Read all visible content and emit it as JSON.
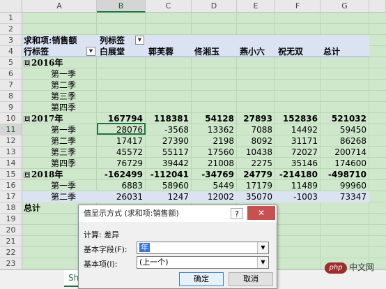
{
  "columns": [
    "A",
    "B",
    "C",
    "D",
    "E",
    "F",
    "G"
  ],
  "row_numbers": [
    "1",
    "2",
    "3",
    "4",
    "5",
    "6",
    "7",
    "8",
    "9",
    "10",
    "11",
    "12",
    "13",
    "14",
    "15",
    "16",
    "17",
    "18",
    "19",
    "20",
    "21",
    "22",
    "23"
  ],
  "pivot": {
    "value_label": "求和项:销售额",
    "col_label": "列标签",
    "row_label": "行标签",
    "headers": [
      "白展堂",
      "郭芙蓉",
      "佟湘玉",
      "燕小六",
      "祝无双",
      "总计"
    ],
    "collapse_glyph": "⊟",
    "dropdown_glyph": "▼",
    "years": [
      {
        "label": "2016年",
        "values": [
          "",
          "",
          "",
          "",
          "",
          ""
        ],
        "quarters": [
          {
            "label": "第一季",
            "values": [
              "",
              "",
              "",
              "",
              "",
              ""
            ]
          },
          {
            "label": "第二季",
            "values": [
              "",
              "",
              "",
              "",
              "",
              ""
            ]
          },
          {
            "label": "第三季",
            "values": [
              "",
              "",
              "",
              "",
              "",
              ""
            ]
          },
          {
            "label": "第四季",
            "values": [
              "",
              "",
              "",
              "",
              "",
              ""
            ]
          }
        ]
      },
      {
        "label": "2017年",
        "values": [
          "167794",
          "118381",
          "54128",
          "27893",
          "152836",
          "521032"
        ],
        "quarters": [
          {
            "label": "第一季",
            "values": [
              "28076",
              "-3568",
              "13362",
              "7088",
              "14492",
              "59450"
            ]
          },
          {
            "label": "第二季",
            "values": [
              "17417",
              "27390",
              "2198",
              "8092",
              "31171",
              "86268"
            ]
          },
          {
            "label": "第三季",
            "values": [
              "45572",
              "55117",
              "17560",
              "10438",
              "72027",
              "200714"
            ]
          },
          {
            "label": "第四季",
            "values": [
              "76729",
              "39442",
              "21008",
              "2275",
              "35146",
              "174600"
            ]
          }
        ]
      },
      {
        "label": "2018年",
        "values": [
          "-162499",
          "-112041",
          "-34769",
          "24779",
          "-214180",
          "-498710"
        ],
        "quarters": [
          {
            "label": "第一季",
            "values": [
              "6883",
              "58960",
              "5449",
              "17179",
              "11489",
              "99960"
            ]
          },
          {
            "label": "第二季",
            "values": [
              "26031",
              "1247",
              "12002",
              "35070",
              "-1003",
              "73347"
            ]
          }
        ]
      }
    ],
    "grand_total_label": "总计"
  },
  "sheet_tab": "Sh",
  "dialog": {
    "title": "值显示方式 (求和项:销售额)",
    "help": "?",
    "close": "✕",
    "calc_label": "计算: 差异",
    "base_field_label": "基本字段(F):",
    "base_field_value": "年",
    "base_item_label": "基本项(I):",
    "base_item_value": "(上一个)",
    "ok": "确定",
    "cancel": "取消",
    "arrow": "▼"
  },
  "watermark": {
    "logo": "php",
    "text": "中文网"
  }
}
